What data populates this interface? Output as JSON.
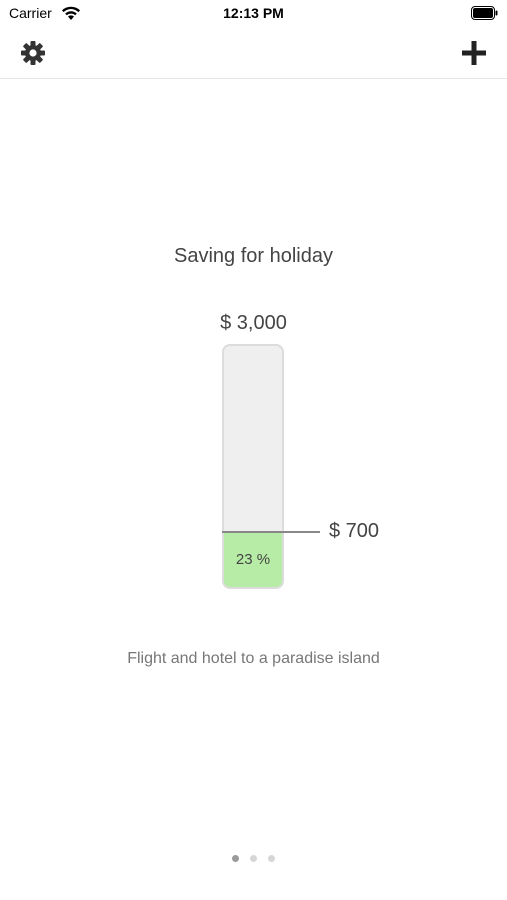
{
  "status_bar": {
    "carrier": "Carrier",
    "time": "12:13 PM",
    "wifi_icon": "wifi-icon",
    "battery_icon": "battery-icon"
  },
  "nav_bar": {
    "left_icon": "gear-icon",
    "right_icon": "plus-icon"
  },
  "goal": {
    "title": "Saving for holiday",
    "target_label": "$ 3,000",
    "current_label": "$ 700",
    "percent_label": "23 %",
    "progress_fraction": 0.23,
    "description": "Flight and hotel to a paradise island"
  },
  "pager": {
    "count": 3,
    "active_index": 0
  },
  "colors": {
    "fill": "#b6eca5",
    "tube": "#efefef",
    "dot_active": "#9a9a9a",
    "dot_inactive": "#d6d6d6"
  }
}
